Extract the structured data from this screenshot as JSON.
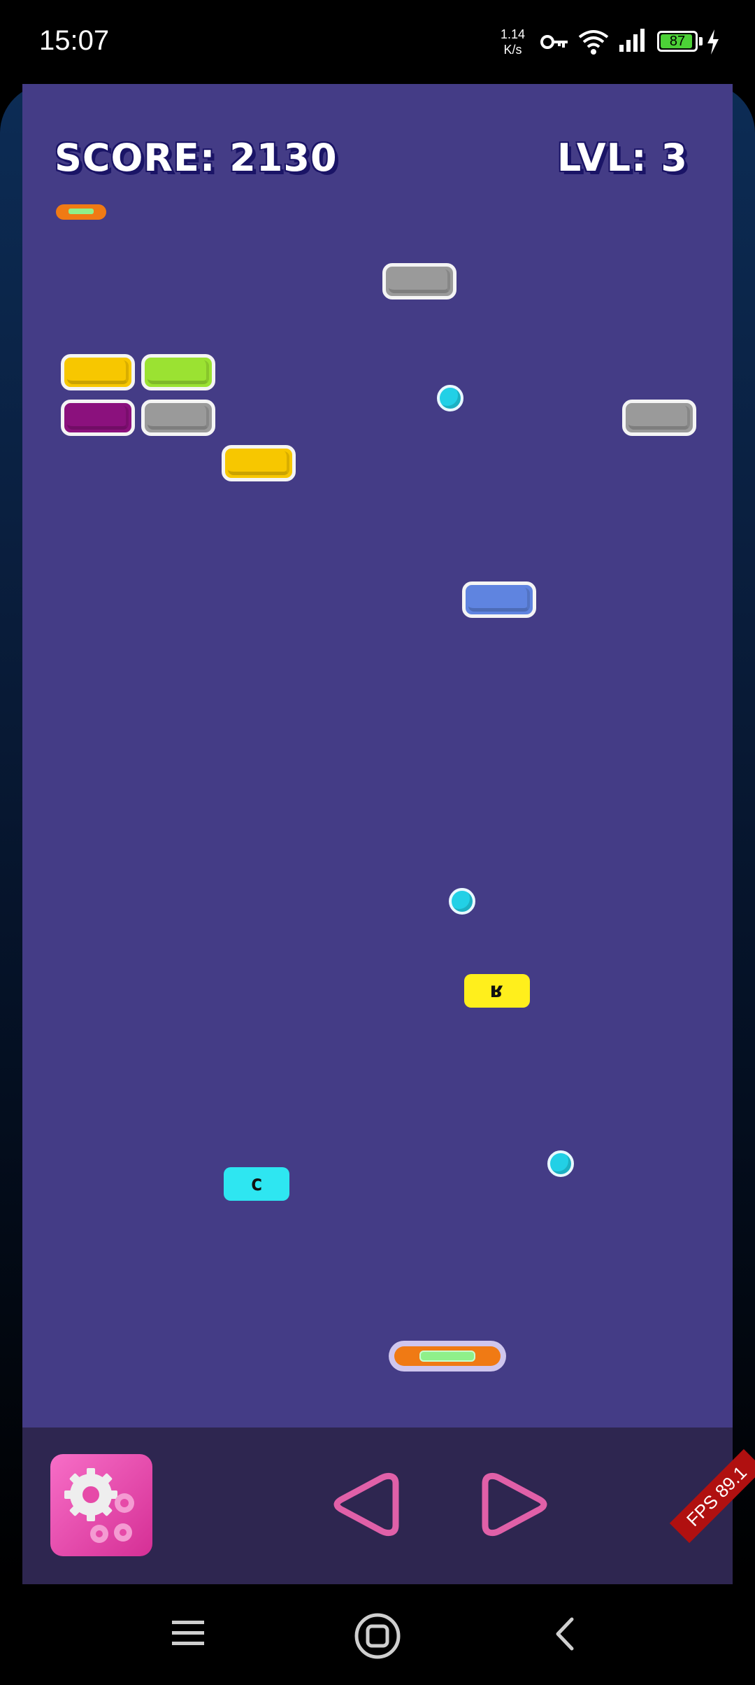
{
  "status_bar": {
    "time": "15:07",
    "net_speed_value": "1.14",
    "net_speed_unit": "K/s",
    "battery_level": "87",
    "icons": [
      "vpn-key-icon",
      "wifi-icon",
      "signal-icon",
      "battery-icon",
      "charging-icon"
    ]
  },
  "hud": {
    "score": "SCORE: 2130",
    "level": "LVL: 3",
    "lives": 1
  },
  "bricks": [
    {
      "color": "#9a9a9a",
      "name": "gray"
    },
    {
      "color": "#f7c700",
      "name": "yellow"
    },
    {
      "color": "#9be232",
      "name": "green"
    },
    {
      "color": "#8b117d",
      "name": "purple"
    },
    {
      "color": "#9a9a9a",
      "name": "gray"
    },
    {
      "color": "#9a9a9a",
      "name": "gray"
    },
    {
      "color": "#f7c700",
      "name": "yellow"
    },
    {
      "color": "#5f84e0",
      "name": "blue"
    }
  ],
  "powerups": [
    {
      "label": "ʁ",
      "color": "#ffef1c"
    },
    {
      "label": "c",
      "color": "#2ee6f1"
    }
  ],
  "balls": 3,
  "controls": {
    "settings_icon": "gears-icon",
    "left_icon": "left-triangle-icon",
    "right_icon": "right-triangle-icon",
    "fps": "FPS 89.1"
  },
  "nav_bar": {
    "icons": [
      "menu-icon",
      "home-icon",
      "back-icon"
    ]
  }
}
